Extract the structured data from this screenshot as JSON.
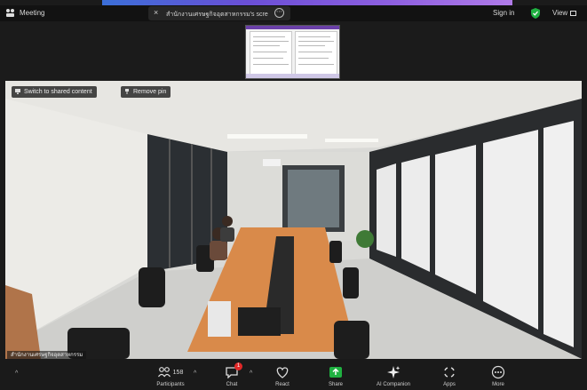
{
  "window": {
    "title": "Meeting",
    "tab_title": "สำนักงานเศรษฐกิจอุตสาหกรรม's scre",
    "tab_close": "×",
    "tab_more": "⋯",
    "sign_in": "Sign in",
    "view_label": "View"
  },
  "video": {
    "switch_label": "Switch to shared content",
    "remove_pin_label": "Remove pin",
    "participant_name": "สำนักงานเศรษฐกิจอุตสาหกรรม"
  },
  "toolbar": {
    "participants_label": "Participants",
    "participants_count": "158",
    "chat_label": "Chat",
    "chat_badge": "1",
    "react_label": "React",
    "share_label": "Share",
    "ai_label": "AI Companion",
    "apps_label": "Apps",
    "more_label": "More",
    "caret": "^"
  },
  "colors": {
    "accent_green": "#1fb141",
    "badge_red": "#e02828",
    "table_orange": "#d98a4a",
    "toolbar_bg": "#1a1a1a"
  },
  "icons": [
    "zoom-logo-icon",
    "shield-check-icon",
    "view-icon",
    "pin-icon",
    "participants-icon",
    "chat-icon",
    "react-icon",
    "share-icon",
    "ai-companion-icon",
    "apps-icon",
    "more-icon"
  ]
}
